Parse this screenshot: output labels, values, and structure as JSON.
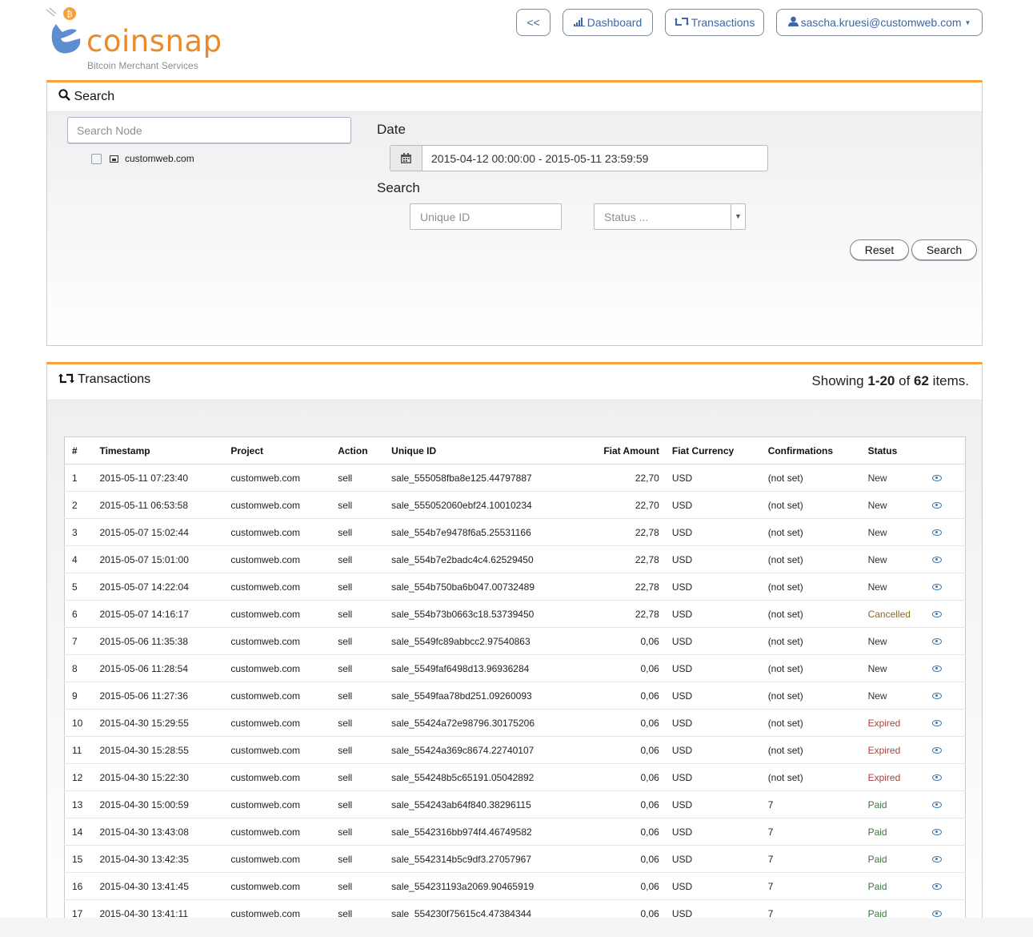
{
  "brand": {
    "name": "coinsnap",
    "tagline": "Bitcoin Merchant Services",
    "accent": "#f7a13b",
    "brand_color": "#e98b2a"
  },
  "topnav": {
    "back_label": "<<",
    "dashboard_label": "Dashboard",
    "transactions_label": "Transactions",
    "user_label": "sascha.kruesi@customweb.com"
  },
  "search_panel": {
    "title": "Search",
    "node_placeholder": "Search Node",
    "tree_item": "customweb.com",
    "date_label": "Date",
    "date_value": "2015-04-12 00:00:00 - 2015-05-11 23:59:59",
    "search_label": "Search",
    "unique_id_placeholder": "Unique ID",
    "status_placeholder": "Status ...",
    "reset_label": "Reset",
    "search_button_label": "Search"
  },
  "transactions_panel": {
    "title": "Transactions",
    "showing_prefix": "Showing ",
    "showing_range": "1-20",
    "showing_mid": " of ",
    "showing_total": "62",
    "showing_suffix": " items.",
    "columns": [
      "#",
      "Timestamp",
      "Project",
      "Action",
      "Unique ID",
      "Fiat Amount",
      "Fiat Currency",
      "Confirmations",
      "Status"
    ],
    "rows": [
      {
        "n": "1",
        "ts": "2015-05-11 07:23:40",
        "project": "customweb.com",
        "action": "sell",
        "uid": "sale_555058fba8e125.44797887",
        "amount": "22,70",
        "currency": "USD",
        "conf": "(not set)",
        "status": "New"
      },
      {
        "n": "2",
        "ts": "2015-05-11 06:53:58",
        "project": "customweb.com",
        "action": "sell",
        "uid": "sale_555052060ebf24.10010234",
        "amount": "22,70",
        "currency": "USD",
        "conf": "(not set)",
        "status": "New"
      },
      {
        "n": "3",
        "ts": "2015-05-07 15:02:44",
        "project": "customweb.com",
        "action": "sell",
        "uid": "sale_554b7e9478f6a5.25531166",
        "amount": "22,78",
        "currency": "USD",
        "conf": "(not set)",
        "status": "New"
      },
      {
        "n": "4",
        "ts": "2015-05-07 15:01:00",
        "project": "customweb.com",
        "action": "sell",
        "uid": "sale_554b7e2badc4c4.62529450",
        "amount": "22,78",
        "currency": "USD",
        "conf": "(not set)",
        "status": "New"
      },
      {
        "n": "5",
        "ts": "2015-05-07 14:22:04",
        "project": "customweb.com",
        "action": "sell",
        "uid": "sale_554b750ba6b047.00732489",
        "amount": "22,78",
        "currency": "USD",
        "conf": "(not set)",
        "status": "New"
      },
      {
        "n": "6",
        "ts": "2015-05-07 14:16:17",
        "project": "customweb.com",
        "action": "sell",
        "uid": "sale_554b73b0663c18.53739450",
        "amount": "22,78",
        "currency": "USD",
        "conf": "(not set)",
        "status": "Cancelled"
      },
      {
        "n": "7",
        "ts": "2015-05-06 11:35:38",
        "project": "customweb.com",
        "action": "sell",
        "uid": "sale_5549fc89abbcc2.97540863",
        "amount": "0,06",
        "currency": "USD",
        "conf": "(not set)",
        "status": "New"
      },
      {
        "n": "8",
        "ts": "2015-05-06 11:28:54",
        "project": "customweb.com",
        "action": "sell",
        "uid": "sale_5549faf6498d13.96936284",
        "amount": "0,06",
        "currency": "USD",
        "conf": "(not set)",
        "status": "New"
      },
      {
        "n": "9",
        "ts": "2015-05-06 11:27:36",
        "project": "customweb.com",
        "action": "sell",
        "uid": "sale_5549faa78bd251.09260093",
        "amount": "0,06",
        "currency": "USD",
        "conf": "(not set)",
        "status": "New"
      },
      {
        "n": "10",
        "ts": "2015-04-30 15:29:55",
        "project": "customweb.com",
        "action": "sell",
        "uid": "sale_55424a72e98796.30175206",
        "amount": "0,06",
        "currency": "USD",
        "conf": "(not set)",
        "status": "Expired"
      },
      {
        "n": "11",
        "ts": "2015-04-30 15:28:55",
        "project": "customweb.com",
        "action": "sell",
        "uid": "sale_55424a369c8674.22740107",
        "amount": "0,06",
        "currency": "USD",
        "conf": "(not set)",
        "status": "Expired"
      },
      {
        "n": "12",
        "ts": "2015-04-30 15:22:30",
        "project": "customweb.com",
        "action": "sell",
        "uid": "sale_554248b5c65191.05042892",
        "amount": "0,06",
        "currency": "USD",
        "conf": "(not set)",
        "status": "Expired"
      },
      {
        "n": "13",
        "ts": "2015-04-30 15:00:59",
        "project": "customweb.com",
        "action": "sell",
        "uid": "sale_554243ab64f840.38296115",
        "amount": "0,06",
        "currency": "USD",
        "conf": "7",
        "status": "Paid"
      },
      {
        "n": "14",
        "ts": "2015-04-30 13:43:08",
        "project": "customweb.com",
        "action": "sell",
        "uid": "sale_5542316bb974f4.46749582",
        "amount": "0,06",
        "currency": "USD",
        "conf": "7",
        "status": "Paid"
      },
      {
        "n": "15",
        "ts": "2015-04-30 13:42:35",
        "project": "customweb.com",
        "action": "sell",
        "uid": "sale_5542314b5c9df3.27057967",
        "amount": "0,06",
        "currency": "USD",
        "conf": "7",
        "status": "Paid"
      },
      {
        "n": "16",
        "ts": "2015-04-30 13:41:45",
        "project": "customweb.com",
        "action": "sell",
        "uid": "sale_554231193a2069.90465919",
        "amount": "0,06",
        "currency": "USD",
        "conf": "7",
        "status": "Paid"
      },
      {
        "n": "17",
        "ts": "2015-04-30 13:41:11",
        "project": "customweb.com",
        "action": "sell",
        "uid": "sale_554230f75615c4.47384344",
        "amount": "0,06",
        "currency": "USD",
        "conf": "7",
        "status": "Paid"
      }
    ]
  },
  "status_colors": {
    "New": "#333333",
    "Cancelled": "#8a6a2c",
    "Expired": "#a94442",
    "Paid": "#3c763d"
  }
}
